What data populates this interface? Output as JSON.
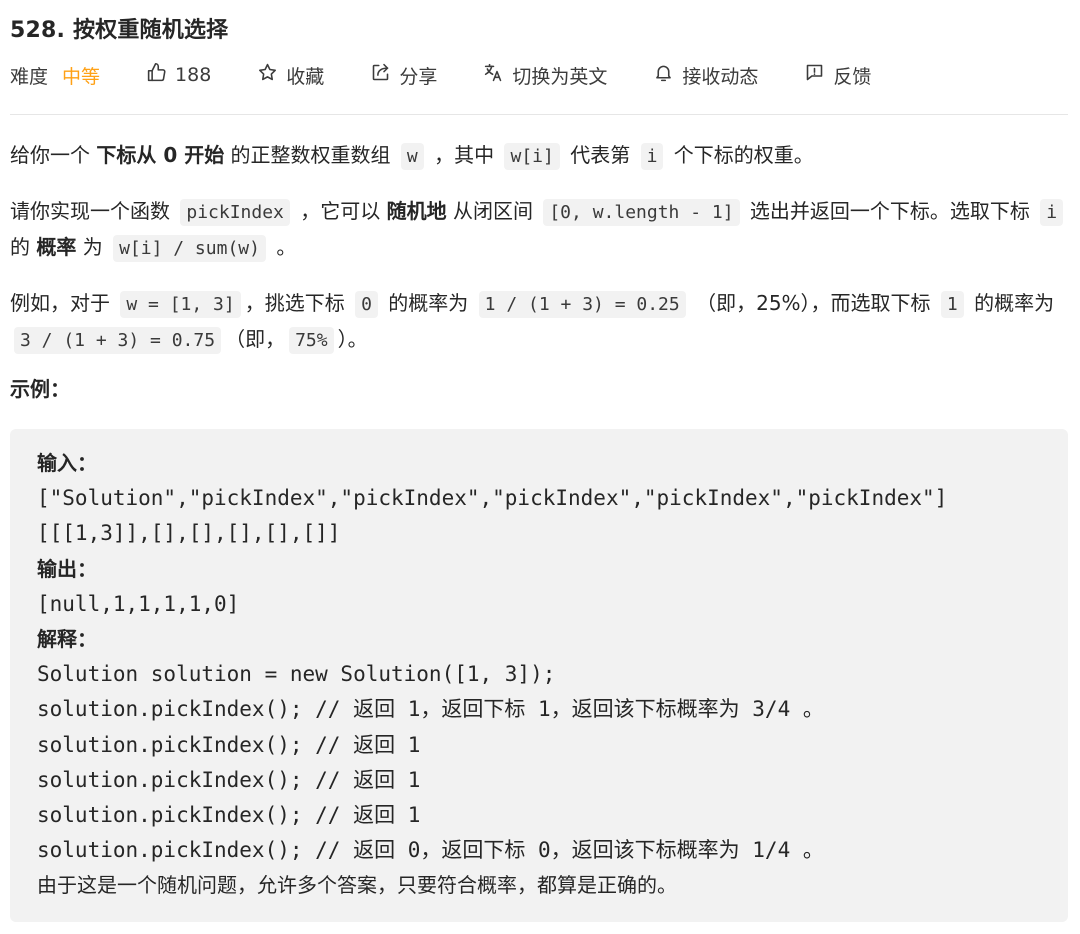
{
  "problem": {
    "title": "528. 按权重随机选择"
  },
  "toolbar": {
    "difficulty_label": "难度",
    "difficulty_value": "中等",
    "difficulty_color": "#ffa116",
    "likes_count": "188",
    "favorite_label": "收藏",
    "share_label": "分享",
    "translate_label": "切换为英文",
    "notify_label": "接收动态",
    "feedback_label": "反馈",
    "icons": [
      "thumbs-up-icon",
      "star-icon",
      "share-icon",
      "translate-icon",
      "bell-icon",
      "feedback-icon"
    ]
  },
  "description": {
    "p1": {
      "t1": "给你一个 ",
      "b1": "下标从 0 开始",
      "t2": " 的正整数权重数组 ",
      "c1": "w",
      "t3": " ，其中 ",
      "c2": "w[i]",
      "t4": " 代表第 ",
      "c3": "i",
      "t5": " 个下标的权重。"
    },
    "p2": {
      "t1": "请你实现一个函数 ",
      "c1": "pickIndex",
      "t2": " ，它可以 ",
      "b1": "随机地",
      "t3": " 从闭区间 ",
      "c2": "[0, w.length - 1]",
      "t4": " 选出并返回一个下标。选取下标 ",
      "c3": "i",
      "t5": " 的 ",
      "b2": "概率",
      "t6": " 为 ",
      "c4": "w[i] / sum(w)",
      "t7": " 。"
    },
    "p3": {
      "t1": "例如，对于 ",
      "c1": "w = [1, 3]",
      "t2": "，挑选下标 ",
      "c2": "0",
      "t3": " 的概率为 ",
      "c3": "1 / (1 + 3) = 0.25",
      "t4": " （即，25%），而选取下标 ",
      "c4": "1",
      "t5": " 的概率为 ",
      "c5": "3 / (1 + 3) = 0.75",
      "t6": "（即，",
      "c6": "75%",
      "t7": "）。"
    }
  },
  "example": {
    "heading": "示例：",
    "input_label": "输入：",
    "input_line1": "[\"Solution\",\"pickIndex\",\"pickIndex\",\"pickIndex\",\"pickIndex\",\"pickIndex\"]",
    "input_line2": "[[[1,3]],[],[],[],[],[]]",
    "output_label": "输出：",
    "output_line": "[null,1,1,1,1,0]",
    "explain_label": "解释：",
    "explain_lines": [
      "Solution solution = new Solution([1, 3]);",
      "solution.pickIndex(); // 返回 1，返回下标 1，返回该下标概率为 3/4 。",
      "solution.pickIndex(); // 返回 1",
      "solution.pickIndex(); // 返回 1",
      "solution.pickIndex(); // 返回 1",
      "solution.pickIndex(); // 返回 0，返回下标 0，返回该下标概率为 1/4 。"
    ],
    "footer_line": "由于这是一个随机问题，允许多个答案，只要符合概率，都算是正确的。"
  }
}
